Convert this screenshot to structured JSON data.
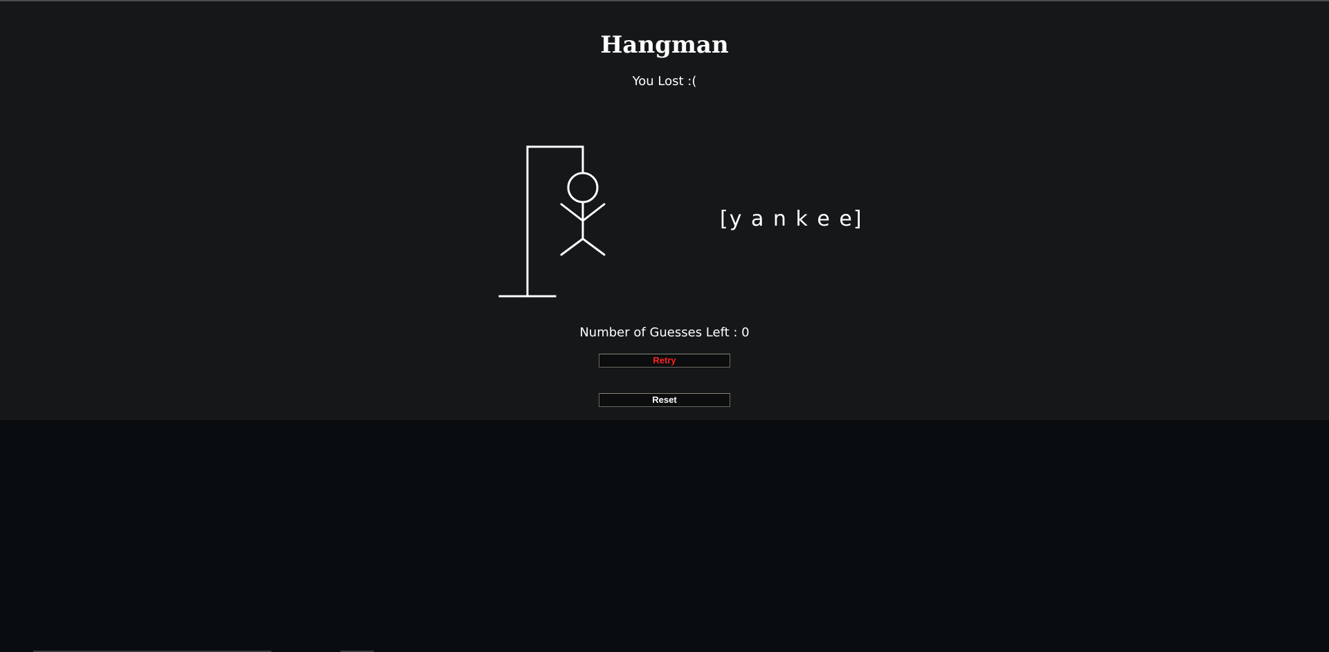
{
  "game": {
    "title": "Hangman",
    "status": "You Lost :(",
    "word_display": "[y a n k e e]",
    "guesses_left_text": "Number of Guesses Left : 0",
    "guesses_left": 0
  },
  "buttons": {
    "retry_label": "Retry",
    "reset_label": "Reset"
  },
  "colors": {
    "panel_background": "#151719",
    "page_background": "#0a0d0f",
    "text": "#ffffff",
    "retry_text": "#ff2424"
  }
}
